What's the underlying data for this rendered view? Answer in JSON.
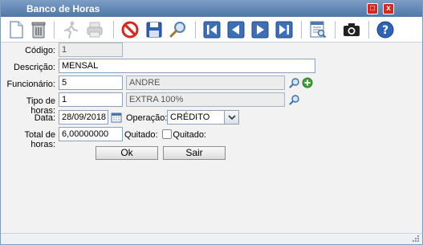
{
  "window": {
    "title": "Banco de Horas",
    "maximize_symbol": "□",
    "close_symbol": "x",
    "accent": "#d9271f"
  },
  "toolbar": {
    "buttons": [
      "new-document-icon",
      "trash-icon",
      "run-icon",
      "print-icon",
      "cancel-icon",
      "save-icon",
      "search-icon",
      "first-record-icon",
      "previous-record-icon",
      "next-record-icon",
      "last-record-icon",
      "report-icon",
      "camera-icon",
      "help-icon"
    ]
  },
  "form": {
    "codigo_label": "Código:",
    "codigo_value": "1",
    "descricao_label": "Descrição:",
    "descricao_value": "MENSAL",
    "funcionario_label": "Funcionário:",
    "funcionario_id": "5",
    "funcionario_name": "ANDRE",
    "tipo_label": "Tipo de horas:",
    "tipo_id": "1",
    "tipo_name": "EXTRA 100%",
    "data_label": "Data:",
    "data_value": "28/09/2018",
    "operacao_label": "Operação:",
    "operacao_value": "CRÉDITO",
    "total_label": "Total de horas:",
    "total_value": "6,00000000",
    "quitado_label": "Quitado:",
    "quitado_check_label": "Quitado:",
    "quitado_checked": false
  },
  "actions": {
    "ok_label": "Ok",
    "sair_label": "Sair"
  }
}
